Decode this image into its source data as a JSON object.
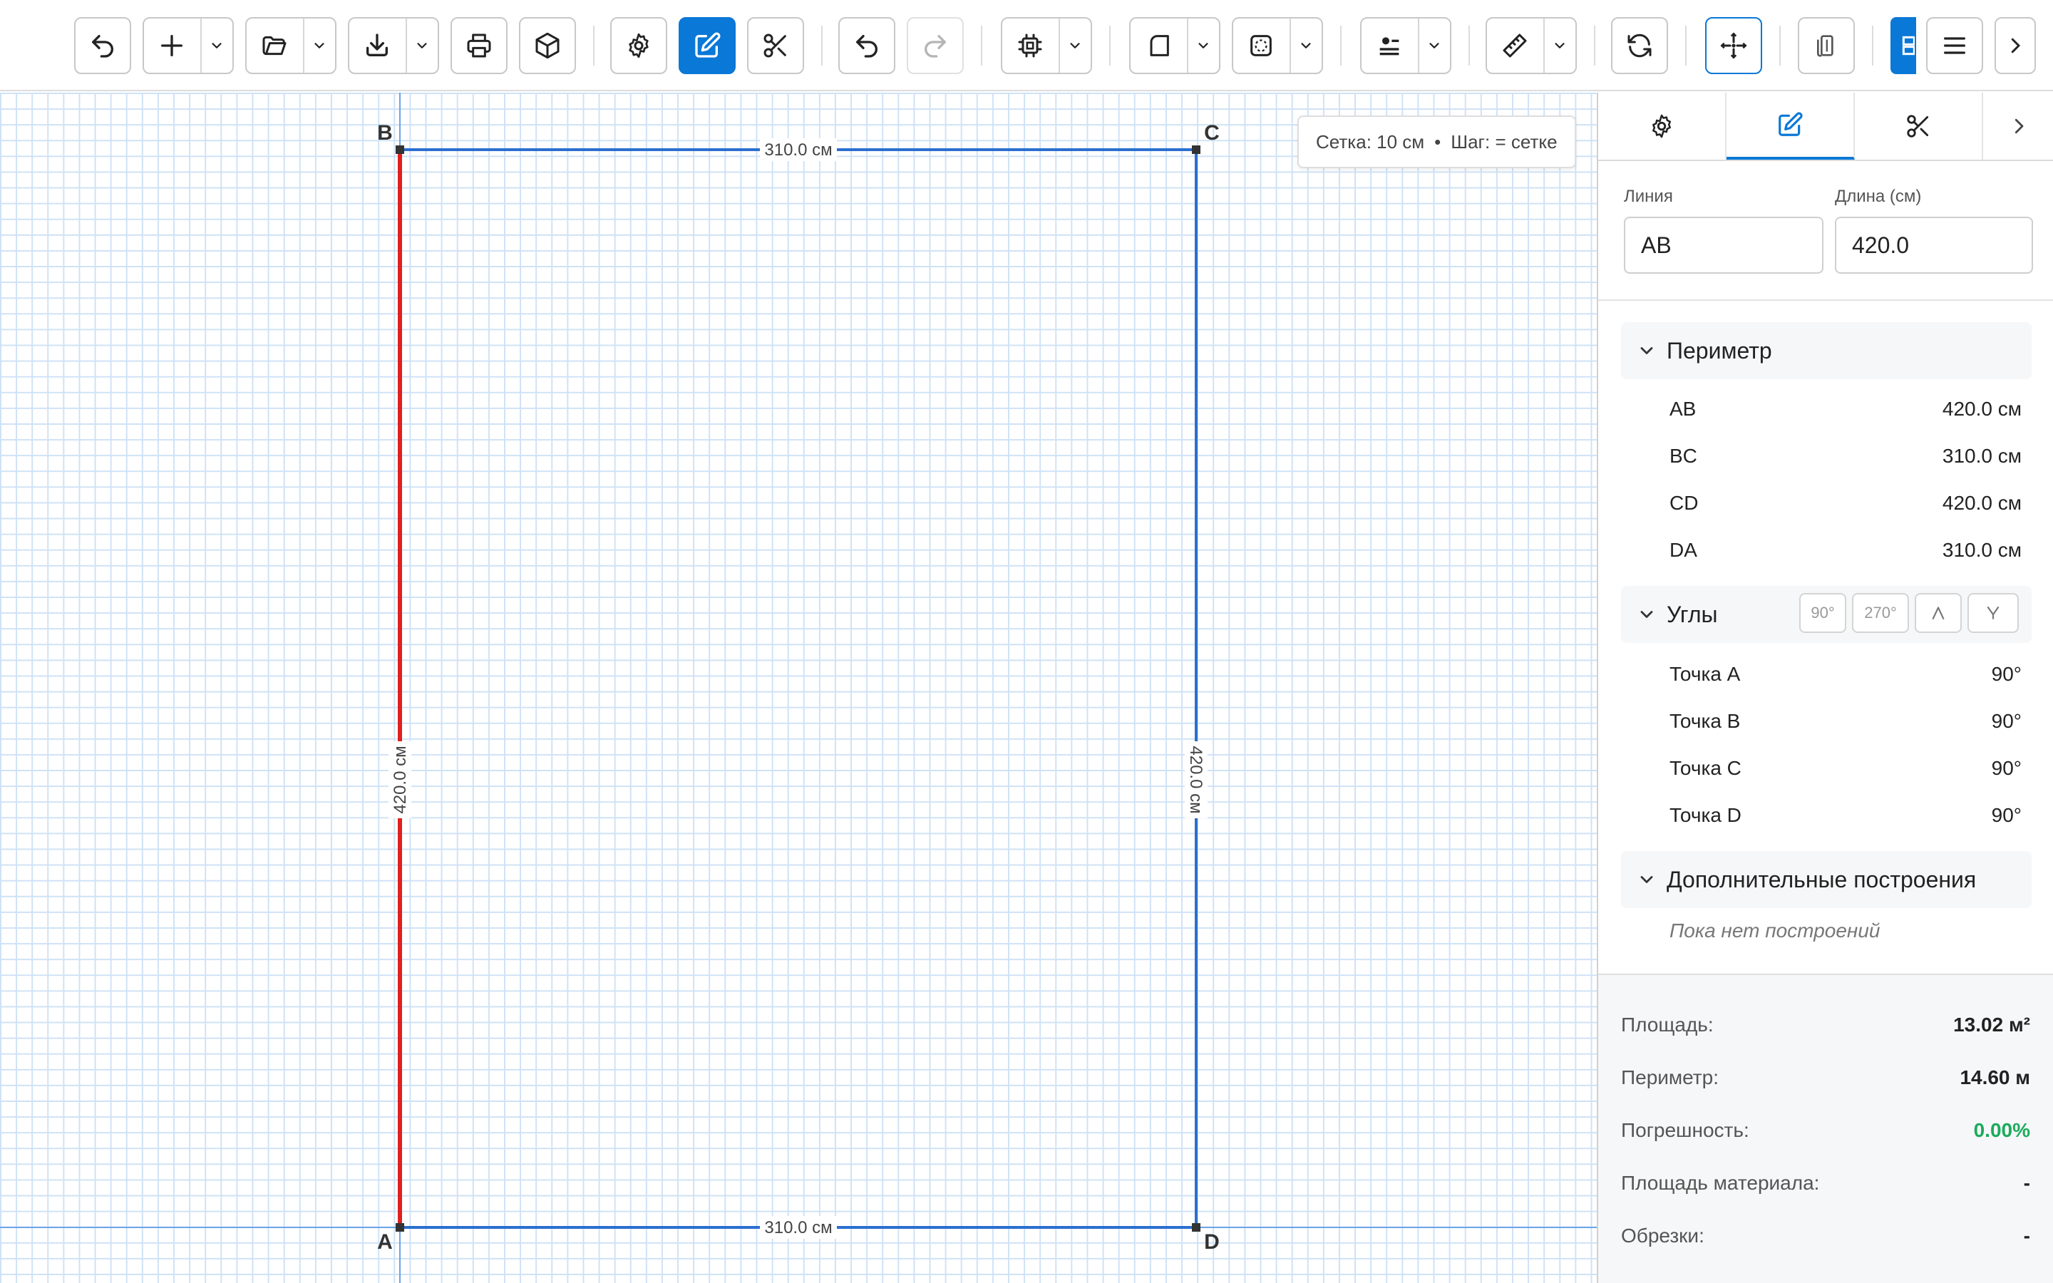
{
  "canvas": {
    "hint": {
      "grid": "Сетка: 10 см",
      "separator": "•",
      "step": "Шаг: = сетке"
    },
    "points": {
      "A": "A",
      "B": "B",
      "C": "C",
      "D": "D"
    },
    "dimensions": {
      "AB": "420.0 см",
      "BC": "310.0 см",
      "CD": "420.0 см",
      "DA": "310.0 см"
    }
  },
  "colors": {
    "accent": "#0a78d7",
    "selected_line": "#e02020",
    "line": "#2a6fd0",
    "positive": "#1aab5c"
  },
  "panel": {
    "line_label": "Линия",
    "line_value": "AB",
    "length_label": "Длина (см)",
    "length_value": "420.0",
    "perimeter": {
      "title": "Периметр",
      "rows": [
        {
          "name": "AB",
          "value": "420.0 см"
        },
        {
          "name": "BC",
          "value": "310.0 см"
        },
        {
          "name": "CD",
          "value": "420.0 см"
        },
        {
          "name": "DA",
          "value": "310.0 см"
        }
      ]
    },
    "angles": {
      "title": "Углы",
      "btn_90": "90°",
      "btn_270": "270°",
      "rows": [
        {
          "name": "Точка A",
          "value": "90°"
        },
        {
          "name": "Точка B",
          "value": "90°"
        },
        {
          "name": "Точка C",
          "value": "90°"
        },
        {
          "name": "Точка D",
          "value": "90°"
        }
      ]
    },
    "extra": {
      "title": "Дополнительные построения",
      "empty": "Пока нет построений"
    },
    "summary": [
      {
        "label": "Площадь:",
        "value": "13.02 м²"
      },
      {
        "label": "Периметр:",
        "value": "14.60 м"
      },
      {
        "label": "Погрешность:",
        "value": "0.00%"
      },
      {
        "label": "Площадь материала:",
        "value": "-"
      },
      {
        "label": "Обрезки:",
        "value": "-"
      }
    ]
  }
}
